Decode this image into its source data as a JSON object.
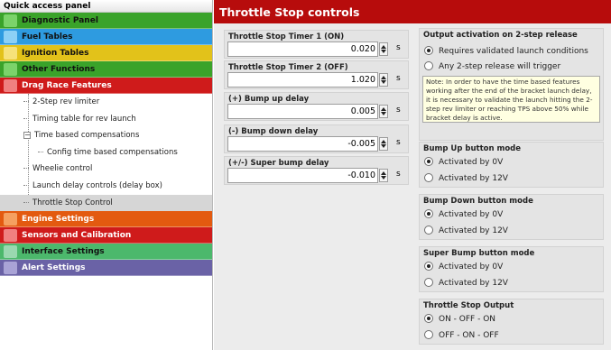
{
  "sidebar": {
    "title": "Quick access panel",
    "categories_top": [
      {
        "label": "Diagnostic Panel",
        "color": "#3aa32a",
        "icon": "wrench-icon"
      },
      {
        "label": "Fuel Tables",
        "color": "#2e9be0",
        "icon": "fuel-icon"
      },
      {
        "label": "Ignition Tables",
        "color": "#e2c21a",
        "icon": "spark-icon"
      },
      {
        "label": "Other Functions",
        "color": "#3aa32a",
        "icon": "gear-icon"
      },
      {
        "label": "Drag Race Features",
        "color": "#cf1b1b",
        "icon": "flag-icon"
      }
    ],
    "tree_items": [
      "2-Step rev limiter",
      "Timing table for rev launch",
      "Time based compensations",
      "Config time based compensations",
      "Wheelie control",
      "Launch delay controls (delay box)",
      "Throttle Stop Control"
    ],
    "expander_symbol": "−",
    "categories_bottom": [
      {
        "label": "Engine Settings",
        "color": "#e35a10",
        "icon": "engine-icon"
      },
      {
        "label": "Sensors and Calibration",
        "color": "#cf1b1b",
        "icon": "sensor-icon"
      },
      {
        "label": "Interface Settings",
        "color": "#4cb86c",
        "icon": "monitor-icon"
      },
      {
        "label": "Alert Settings",
        "color": "#6a62a6",
        "icon": "alert-icon"
      }
    ]
  },
  "main": {
    "title": "Throttle Stop controls",
    "fields": [
      {
        "label": "Throttle Stop Timer 1 (ON)",
        "value": "0.020",
        "unit": "s"
      },
      {
        "label": "Throttle Stop Timer 2 (OFF)",
        "value": "1.020",
        "unit": "s"
      },
      {
        "label": "(+) Bump up delay",
        "value": "0.005",
        "unit": "s"
      },
      {
        "label": "(-) Bump down delay",
        "value": "-0.005",
        "unit": "s"
      },
      {
        "label": "(+/-) Super bump delay",
        "value": "-0.010",
        "unit": "s"
      }
    ],
    "output_activation": {
      "title": "Output activation on 2-step release",
      "options": [
        "Requires validated launch conditions",
        "Any 2-step release will trigger"
      ],
      "selected": 0,
      "note": "Note: In order to have the time based features working after the end of the bracket launch delay, it is necessary to validate the launch hitting the 2-step rev limiter or reaching TPS above 50% while bracket delay is active."
    },
    "bump_up": {
      "title": "Bump Up button mode",
      "options": [
        "Activated by 0V",
        "Activated by 12V"
      ],
      "selected": 0
    },
    "bump_down": {
      "title": "Bump Down button mode",
      "options": [
        "Activated by 0V",
        "Activated by 12V"
      ],
      "selected": 0
    },
    "super_bump": {
      "title": "Super Bump button mode",
      "options": [
        "Activated by 0V",
        "Activated by 12V"
      ],
      "selected": 0
    },
    "throttle_output": {
      "title": "Throttle Stop Output",
      "options": [
        "ON - OFF - ON",
        "OFF - ON - OFF"
      ],
      "selected": 0
    }
  }
}
